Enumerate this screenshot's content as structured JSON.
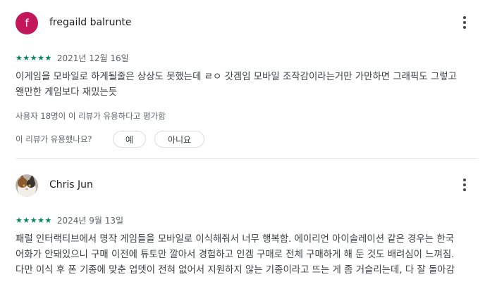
{
  "reviews": [
    {
      "avatar_letter": "f",
      "author": "fregaild balrunte",
      "stars": "★★★★★",
      "date": "2021년 12월 16일",
      "text_lines": [
        "이게임을 모바일로 하게될줄은 상상도 못했는데 ㄹㅇ 갓겜임 모바일 조작감이라는거만 가만하면 그래픽도 그렇고",
        "왠만한 게임보다 재밌는듯"
      ],
      "helpful_count": "사용자 18명이 이 리뷰가 유용하다고 평가함",
      "helpful_question": "이 리뷰가 유용했나요?",
      "yes_label": "예",
      "no_label": "아니요"
    },
    {
      "author": "Chris Jun",
      "stars": "★★★★★",
      "date": "2024년 9월 13일",
      "text_lines": [
        "패럴 인터랙티브에서 명작 게임들을 모바일로 이식해줘서 너무 행복함. 에이리언 아이솔레이션 같은 경우는 한국",
        "어화가 안돼있으니 구매 이전에 튜토만 깔아서 경험하고 인겜 구매로 전체 구매하게 해 둔 것도 배려심이 느껴짐.",
        "다만 이식 후 폰 기종에 맞춘 업뎃이 전혀 없어서 지원하지 않는 기종이라고 뜨는 게 좀 거슬리는데, 다 잘 돌아감"
      ]
    }
  ],
  "colors": {
    "accent_green": "#01875f",
    "avatar_bg": "#c2185b"
  },
  "icons": {
    "more": "more-vert-icon"
  }
}
